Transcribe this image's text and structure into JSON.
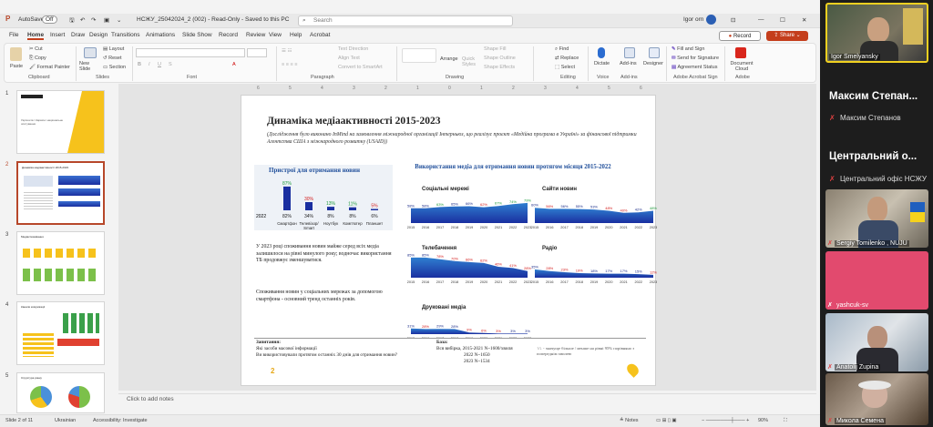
{
  "titlebar": {
    "autosave": "AutoSave",
    "autosave_state": "Off",
    "filename": "НСЖУ_25042024_2 (002)  -  Read-Only  -  Saved to this PC",
    "search_placeholder": "Search",
    "user": "Igor orn"
  },
  "menu": [
    "File",
    "Home",
    "Insert",
    "Draw",
    "Design",
    "Transitions",
    "Animations",
    "Slide Show",
    "Record",
    "Review",
    "View",
    "Help",
    "Acrobat"
  ],
  "menu_active": "Home",
  "record_label": "Record",
  "share_label": "Share",
  "ribbon": {
    "paste": "Paste",
    "cut": "Cut",
    "copy": "Copy",
    "format_painter": "Format Painter",
    "clipboard": "Clipboard",
    "new_slide": "New Slide",
    "layout": "Layout",
    "reset": "Reset",
    "section": "Section",
    "slides": "Slides",
    "font": "Font",
    "text_direction": "Text Direction",
    "align_text": "Align Text",
    "convert_smartart": "Convert to SmartArt",
    "paragraph": "Paragraph",
    "arrange": "Arrange",
    "quick_styles": "Quick Styles",
    "shape_fill": "Shape Fill",
    "shape_outline": "Shape Outline",
    "shape_effects": "Shape Effects",
    "drawing": "Drawing",
    "find": "Find",
    "replace": "Replace",
    "select": "Select",
    "editing": "Editing",
    "dictate": "Dictate",
    "voice": "Voice",
    "addins": "Add-ins",
    "designer": "Designer",
    "fill_sign": "Fill and Sign",
    "send_signature": "Send for Signature",
    "agreement_status": "Agreement Status",
    "adobe_sign": "Adobe Acrobat Sign",
    "document_cloud": "Document Cloud",
    "adobe": "Adobe"
  },
  "thumbnails": [
    {
      "num": "1",
      "text": "Укрпошта / Каразін і національне опитування"
    },
    {
      "num": "2",
      "text": "Динаміка медіаактивності 2015-2023"
    },
    {
      "num": "3",
      "text": "Медіаспоживання"
    },
    {
      "num": "4",
      "text": "Канали комунікації"
    },
    {
      "num": "5",
      "text": "Структура ринку"
    }
  ],
  "ruler_ticks": [
    "6",
    "5",
    "4",
    "3",
    "2",
    "1",
    "0",
    "1",
    "2",
    "3",
    "4",
    "5",
    "6"
  ],
  "slide": {
    "title": "Динаміка медіаактивності 2015-2023",
    "subtitle": "(Дослідження було виконано InMind на замовлення міжнародної організації Інтерньюз, що реалізує проєкт «Медійна програма в Україні» за фінансової підтримки Агентства США з міжнародного розвитку (USAID))",
    "devices_title": "Пристрої для отримання новин",
    "devices_year": "2022",
    "right_title": "Використання медіа для отримання новин протягом місяця 2015-2022",
    "paragraph1": "У 2023 році споживання новин майже серед всіх медіа залишилося на рівні минулого року; водночас використання ТБ продовжує зменшуватися.",
    "paragraph2": "Споживання новин у соціальних мережах за допомогою смартфона - основний тренд останніх років.",
    "questions_label": "Запитання:",
    "question1": "Які засоби масової інформації",
    "question2": "Ви використовували протягом останніх 30 днів для отримання новин?",
    "base_label": "База:",
    "base1": "Вся вибірка, 2015-2021 N~1600/хвиля",
    "base2": "2022 N~1650",
    "base3": "2023 N~1534",
    "legend_note": "↑/↓ - значуще більше / менше на рівні 95% порівняно з попереднім хвилею",
    "page": "2"
  },
  "chart_data": [
    {
      "type": "bar",
      "title": "Пристрої для отримання новин",
      "categories": [
        "Смартфон",
        "Телевізор/ Smart TV",
        "Ноутбук",
        "Комп'ютер",
        "Планшет"
      ],
      "series": [
        {
          "name": "2023",
          "values": [
            87,
            30,
            13,
            11,
            5
          ]
        },
        {
          "name": "2022",
          "values": [
            82,
            34,
            8,
            8,
            6
          ]
        }
      ]
    },
    {
      "type": "area",
      "title": "Соціальні мережі",
      "x": [
        "2015",
        "2016",
        "2017",
        "2018",
        "2019",
        "2020",
        "2021",
        "2022",
        "2023"
      ],
      "values": [
        58,
        58,
        63,
        65,
        66,
        62,
        67,
        74,
        79
      ]
    },
    {
      "type": "area",
      "title": "Сайти новин",
      "x": [
        "2015",
        "2016",
        "2017",
        "2018",
        "2019",
        "2020",
        "2021",
        "2022",
        "2023"
      ],
      "values": [
        60,
        56,
        56,
        55,
        53,
        48,
        40,
        42,
        48
      ]
    },
    {
      "type": "area",
      "title": "Телебачення",
      "x": [
        "2015",
        "2016",
        "2017",
        "2018",
        "2019",
        "2020",
        "2021",
        "2022",
        "2023"
      ],
      "values": [
        85,
        85,
        78,
        70,
        66,
        62,
        46,
        41,
        28
      ]
    },
    {
      "type": "area",
      "title": "Радіо",
      "x": [
        "2015",
        "2016",
        "2017",
        "2018",
        "2019",
        "2020",
        "2021",
        "2022",
        "2023"
      ],
      "values": [
        35,
        28,
        23,
        19,
        18,
        17,
        17,
        15,
        12
      ]
    },
    {
      "type": "area",
      "title": "Друковані медіа",
      "x": [
        "2015",
        "2016",
        "2017",
        "2018",
        "2019",
        "2020",
        "2021",
        "2022",
        "2023"
      ],
      "values": [
        31,
        28,
        29,
        28,
        9,
        6,
        3,
        3,
        3
      ]
    }
  ],
  "notes_placeholder": "Click to add notes",
  "status": {
    "slide": "Slide 2 of 11",
    "language": "Ukrainian",
    "accessibility": "Accessibility: Investigate",
    "notes": "Notes",
    "zoom": "90%"
  },
  "participants": [
    {
      "name": "Igor Smelyansky",
      "video": true
    },
    {
      "name": "Максим Степанов",
      "display": "Максим Степан..."
    },
    {
      "name": "Центральний офіс НСЖУ",
      "display": "Центральний о..."
    },
    {
      "name": "Sergiy Tomilenko , NUJU",
      "video": true
    },
    {
      "name": "yashcuk-sv",
      "video": false
    },
    {
      "name": "Anatolij Zupina",
      "video": true
    },
    {
      "name": "Микола Семена",
      "video": true
    }
  ],
  "colors": {
    "accent": "#c43e1c",
    "chart_dark": "#1a2fa0",
    "chart_light": "#2f7fd0",
    "chart_title": "#1f4e9a",
    "up": "#1e9a3c",
    "down": "#d42020",
    "yashcuk_tile": "#e24a6e"
  }
}
